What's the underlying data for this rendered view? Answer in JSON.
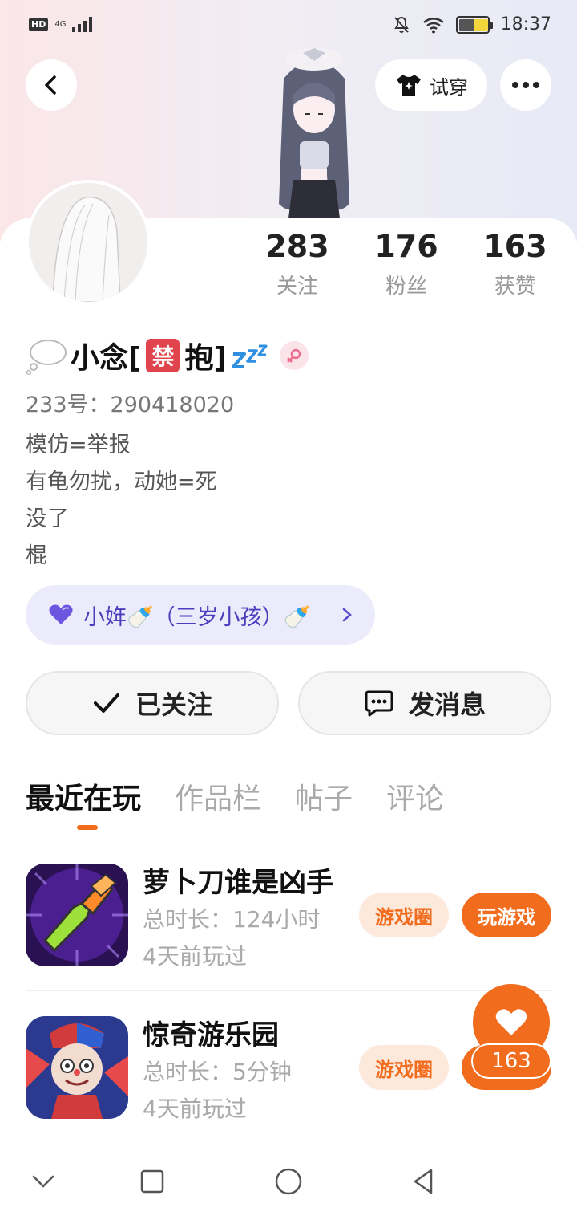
{
  "status_bar": {
    "hd": "HD",
    "network": "4G",
    "battery_level": 0.55,
    "time": "18:37"
  },
  "header": {
    "try_on_label": "试穿"
  },
  "profile": {
    "stats": [
      {
        "value": "283",
        "label": "关注"
      },
      {
        "value": "176",
        "label": "粉丝"
      },
      {
        "value": "163",
        "label": "获赞"
      }
    ],
    "name_parts": {
      "prefix": "小念[",
      "ban": "禁",
      "suffix": "抱]"
    },
    "id_line": "233号：290418020",
    "bio_lines": [
      "模仿=举报",
      "有龟勿扰，动她=死",
      "没了",
      "棍"
    ],
    "family_tag": "小姩🍼（三岁小孩）🍼"
  },
  "actions": {
    "followed_label": "已关注",
    "message_label": "发消息"
  },
  "tabs": [
    {
      "label": "最近在玩",
      "active": true
    },
    {
      "label": "作品栏",
      "active": false
    },
    {
      "label": "帖子",
      "active": false
    },
    {
      "label": "评论",
      "active": false
    }
  ],
  "games": [
    {
      "title": "萝卜刀谁是凶手",
      "duration": "总时长：124小时",
      "last_played": "4天前玩过",
      "circle_label": "游戏圈",
      "play_label": "玩游戏"
    },
    {
      "title": "惊奇游乐园",
      "duration": "总时长：5分钟",
      "last_played": "4天前玩过",
      "circle_label": "游戏圈"
    }
  ],
  "like_count": "163",
  "colors": {
    "accent": "#f26c1d",
    "family_tag_bg": "#ecebfb",
    "family_tag_text": "#4d3dbd"
  }
}
